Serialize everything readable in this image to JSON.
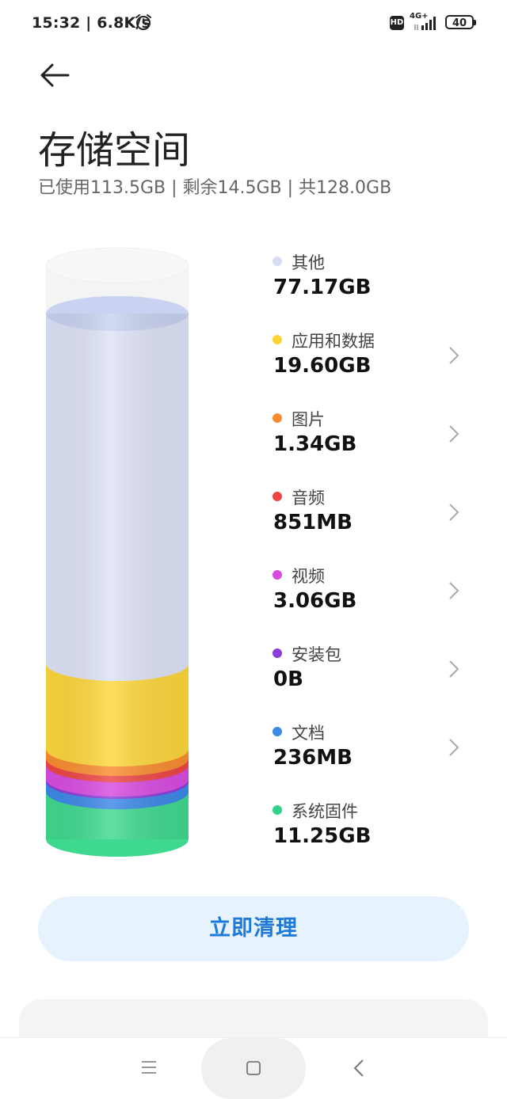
{
  "status_bar": {
    "time_speed": "15:32 | 6.8K/s",
    "hd_label": "HD",
    "network": "4G+",
    "battery": "40",
    "icons": [
      "alarm-icon",
      "hd-icon",
      "signal-icon",
      "battery-icon"
    ]
  },
  "header": {
    "back_icon": "arrow-left-icon",
    "title": "存储空间",
    "summary": "已使用113.5GB | 剩余14.5GB | 共128.0GB"
  },
  "storage": {
    "items": [
      {
        "name": "其他",
        "size": "77.17GB",
        "color": "#d6dcf4",
        "has_arrow": false
      },
      {
        "name": "应用和数据",
        "size": "19.60GB",
        "color": "#fcd334",
        "has_arrow": true
      },
      {
        "name": "图片",
        "size": "1.34GB",
        "color": "#f98c31",
        "has_arrow": true
      },
      {
        "name": "音频",
        "size": "851MB",
        "color": "#ed4545",
        "has_arrow": true
      },
      {
        "name": "视频",
        "size": "3.06GB",
        "color": "#d74be0",
        "has_arrow": true
      },
      {
        "name": "安装包",
        "size": "0B",
        "color": "#8a3ddb",
        "has_arrow": true
      },
      {
        "name": "文档",
        "size": "236MB",
        "color": "#3b88e6",
        "has_arrow": true
      },
      {
        "name": "系统固件",
        "size": "11.25GB",
        "color": "#33d28a",
        "has_arrow": false
      }
    ]
  },
  "actions": {
    "clean_label": "立即清理"
  },
  "navbar": {
    "icons": [
      "menu-icon",
      "home-icon",
      "back-icon"
    ]
  }
}
